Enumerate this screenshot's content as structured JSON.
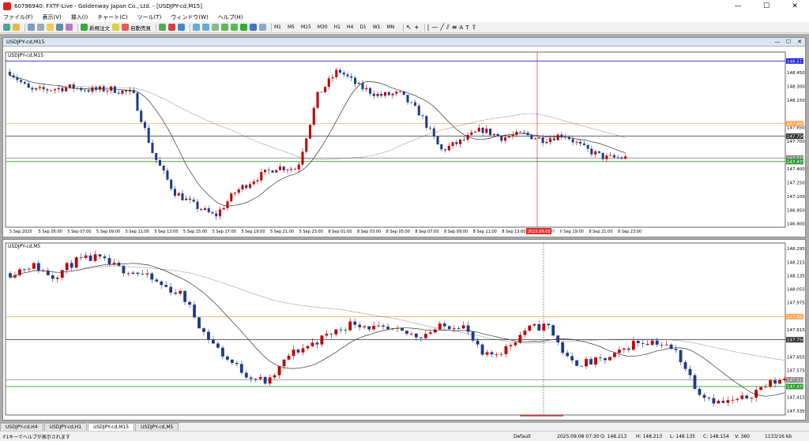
{
  "window": {
    "title": "60796940: FXTF-Live - Goldenway Japan Co., Ltd. - [USDJPY-cd,M15]",
    "minimize": "—",
    "maximize": "☐",
    "close": "✕"
  },
  "menu": [
    "ファイル(F)",
    "表示(V)",
    "挿入(I)",
    "チャート(C)",
    "ツール(T)",
    "ウィンドウ(W)",
    "ヘルプ(H)"
  ],
  "toolbar": {
    "new_order_label": "新規注文",
    "auto_trade_label": "自動売買",
    "timeframes": [
      "M1",
      "M5",
      "M15",
      "M30",
      "H1",
      "H4",
      "D1",
      "W1",
      "MN"
    ]
  },
  "charts": [
    {
      "title": "USDJPY-cd,M15",
      "inner_label": "USDJPY-cd,M15",
      "prices": [
        "148.577",
        "148.450",
        "148.300",
        "148.150",
        "147.893",
        "147.850",
        "147.756",
        "147.700",
        "147.518",
        "147.479",
        "147.400",
        "147.250",
        "147.100",
        "146.950",
        "146.800"
      ],
      "line_labels": {
        "blue": "148.577",
        "orange": "147.893",
        "black": "147.756",
        "gray": "147.518",
        "green": "147.479"
      },
      "times": [
        "5 Sep 2025",
        "5 Sep 05:00",
        "5 Sep 07:00",
        "5 Sep 09:00",
        "5 Sep 11:00",
        "5 Sep 13:00",
        "5 Sep 15:00",
        "5 Sep 17:00",
        "5 Sep 19:00",
        "5 Sep 21:00",
        "5 Sep 23:00",
        "8 Sep 01:00",
        "8 Sep 03:00",
        "8 Sep 05:00",
        "8 Sep 07:00",
        "8 Sep 09:00",
        "8 Sep 11:00",
        "8 Sep 13:00",
        "8 Sep 15:00",
        "8 Sep 19:00",
        "8 Sep 21:00",
        "8 Sep 23:00"
      ],
      "cursor_time": "2025.09.08 16:15"
    },
    {
      "title": "USDJPY-cd,M5",
      "inner_label": "USDJPY-cd,M5",
      "prices": [
        "148.295",
        "148.215",
        "148.135",
        "148.055",
        "147.975",
        "147.893",
        "147.815",
        "147.756",
        "147.655",
        "147.575",
        "147.518",
        "147.479",
        "147.415",
        "147.335"
      ],
      "line_labels": {
        "orange": "147.893",
        "black": "147.756",
        "gray": "147.518",
        "green": "147.479"
      }
    }
  ],
  "tabs": [
    "USDJPY-cd,H4",
    "USDJPY-cd,H1",
    "USDJPY-cd,M15",
    "USDJPY-cd,M5"
  ],
  "status": {
    "help": "F1キーでヘルプが表示されます",
    "profile": "Default",
    "datetime": "2025.09.08 07:30",
    "open": "O: 148.213",
    "high": "H: 148.213",
    "low": "L: 148.135",
    "close": "C: 148.154",
    "volume": "V: 360",
    "traffic": "1133/16 kb"
  },
  "colors": {
    "bull": "#c00000",
    "bear": "#1f3a8a",
    "blue_line": "#2020e0",
    "orange_line": "#ffa64d",
    "green_line": "#2a9d2a",
    "cursor": "#e03030"
  }
}
